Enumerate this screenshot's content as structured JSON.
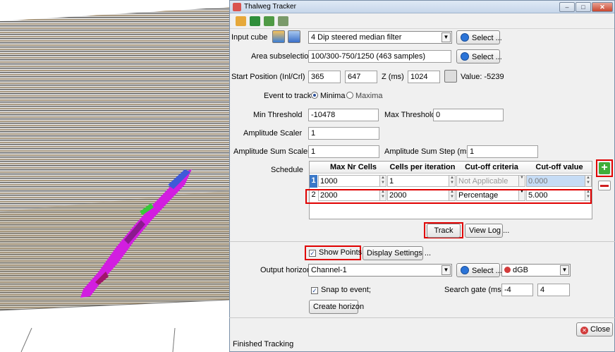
{
  "window": {
    "title": "Thalweg Tracker"
  },
  "form": {
    "input_cube_label": "Input cube",
    "input_cube_value": "4 Dip steered median filter",
    "select_label": "Select ...",
    "area_label": "Area subselection",
    "area_value": "100/300-750/1250 (463 samples)",
    "start_label": "Start Position (Inl/Crl)",
    "start_inl": "365",
    "start_crl": "647",
    "z_label": "Z (ms)",
    "z_value": "1024",
    "value_text": "Value: -5239",
    "event_label": "Event to track",
    "event_minima": "Minima",
    "event_maxima": "Maxima",
    "min_threshold_label": "Min Threshold",
    "min_threshold_value": "-10478",
    "max_threshold_label": "Max Threshold",
    "max_threshold_value": "0",
    "amp_scaler_label": "Amplitude Scaler",
    "amp_scaler_value": "1",
    "amp_sum_scaler_label": "Amplitude Sum Scaler",
    "amp_sum_scaler_value": "1",
    "amp_sum_step_label": "Amplitude Sum Step (ms)",
    "amp_sum_step_value": "1",
    "schedule_label": "Schedule"
  },
  "schedule": {
    "headers": [
      "Max Nr Cells",
      "Cells per iteration",
      "Cut-off criteria",
      "Cut-off value"
    ],
    "rows": [
      {
        "num": "1",
        "max_cells": "1000",
        "cells_per_iter": "1",
        "criteria": "Not Applicable",
        "value": "0.000"
      },
      {
        "num": "2",
        "max_cells": "2000",
        "cells_per_iter": "2000",
        "criteria": "Percentage",
        "value": "5.000"
      }
    ]
  },
  "actions": {
    "track_label": "Track",
    "view_log_label": "View Log ...",
    "show_points_label": "Show Points",
    "display_settings_label": "Display Settings ...",
    "output_label": "Output horizon",
    "output_value": "Channel-1",
    "output_select_label": "Select ...",
    "survey_value": "dGB",
    "snap_label": "Snap to event;",
    "search_gate_label": "Search gate (ms)",
    "search_gate_min": "-4",
    "search_gate_max": "4",
    "create_horizon_label": "Create horizon",
    "close_label": "Close"
  },
  "status": {
    "text": "Finished Tracking"
  },
  "colors": {
    "highlight": "#e00000",
    "tracked_points": "#d21ee0"
  }
}
